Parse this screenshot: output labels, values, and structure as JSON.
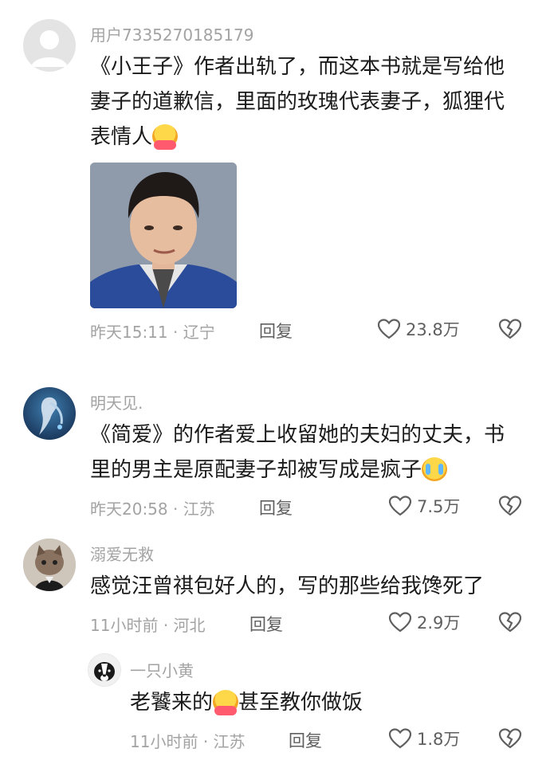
{
  "comments": [
    {
      "username": "用户7335270185179",
      "text_lines": [
        "《小王子》作者出轨了，而这本书就是写给他",
        "妻子的道歉信，里面的玫瑰代表妻子，狐狸代",
        "表情人"
      ],
      "emoji": "hugging-face-emoji",
      "time": "昨天15:11",
      "location": "辽宁",
      "reply": "回复",
      "likes": "23.8万"
    },
    {
      "username": "明天见.",
      "text_lines": [
        "《简爱》的作者爱上收留她的夫妇的丈夫，书",
        "里的男主是原配妻子却被写成是疯子"
      ],
      "emoji": "crying-face-emoji",
      "time": "昨天20:58",
      "location": "江苏",
      "reply": "回复",
      "likes": "7.5万"
    },
    {
      "username": "溺爱无救",
      "text_lines": [
        "感觉汪曾祺包好人的，写的那些给我馋死了"
      ],
      "time": "11小时前",
      "location": "河北",
      "reply": "回复",
      "likes": "2.9万"
    },
    {
      "username": "一只小黄",
      "text_before_emoji": "老饕来的",
      "text_after_emoji": "甚至教你做饭",
      "emoji": "hugging-face-emoji",
      "time": "11小时前",
      "location": "江苏",
      "reply": "回复",
      "likes": "1.8万"
    }
  ],
  "separator": "·",
  "icons": {
    "like": "heart-outline-icon",
    "dislike": "broken-heart-icon"
  },
  "colors": {
    "meta_text": "#a3a3a3",
    "body_text": "#1b1b1b",
    "action_text": "#5f5f5f"
  }
}
